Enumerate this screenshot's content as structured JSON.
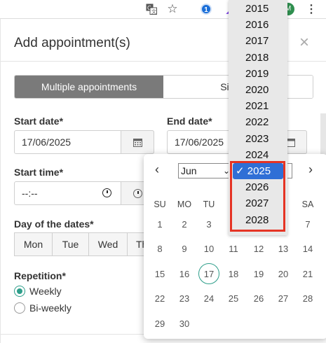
{
  "browser": {
    "profile_initial": "M"
  },
  "dialog": {
    "title": "Add appointment(s)",
    "close_label": "×"
  },
  "mode_toggle": {
    "multiple_label": "Multiple appointments",
    "single_label": "Single a"
  },
  "start_date": {
    "label": "Start date*",
    "value": "17/06/2025"
  },
  "end_date": {
    "label": "End date*",
    "value": "17/06/2025"
  },
  "start_time": {
    "label": "Start time*",
    "value": "--:--"
  },
  "days": {
    "label": "Day of the dates*",
    "items": [
      "Mon",
      "Tue",
      "Wed",
      "Th"
    ]
  },
  "repetition": {
    "label": "Repetition*",
    "options": [
      {
        "label": "Weekly",
        "checked": true
      },
      {
        "label": "Bi-weekly",
        "checked": false
      }
    ]
  },
  "calendar": {
    "prev": "‹",
    "next": "›",
    "month": "Jun",
    "weekday_headers": [
      "SU",
      "MO",
      "TU",
      "",
      "",
      "",
      "SA"
    ],
    "weeks": [
      [
        "1",
        "2",
        "3",
        "",
        "",
        "",
        "7"
      ],
      [
        "8",
        "9",
        "10",
        "11",
        "12",
        "13",
        "14"
      ],
      [
        "15",
        "16",
        "17",
        "18",
        "19",
        "20",
        "21"
      ],
      [
        "22",
        "23",
        "24",
        "25",
        "26",
        "27",
        "28"
      ],
      [
        "29",
        "30",
        "",
        "",
        "",
        "",
        ""
      ]
    ],
    "today": "17"
  },
  "year_dropdown": {
    "years": [
      "2015",
      "2016",
      "2017",
      "2018",
      "2019",
      "2020",
      "2021",
      "2022",
      "2023",
      "2024",
      "2025",
      "2026",
      "2027",
      "2028"
    ],
    "selected": "2025",
    "selected_label": "✓ 2025"
  },
  "colors": {
    "accent": "#2e9e8a",
    "selected_year": "#2f6fd6",
    "highlight": "#e53424",
    "toggle_active": "#7a7a7a"
  }
}
